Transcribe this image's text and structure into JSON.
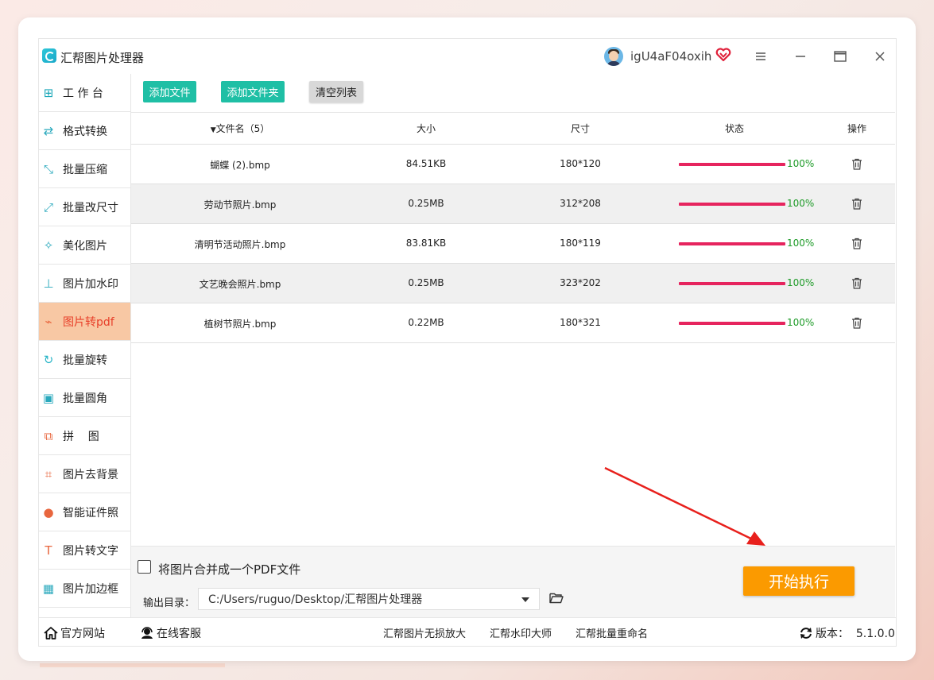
{
  "app": {
    "title": "汇帮图片处理器",
    "username": "igU4aF04oxih"
  },
  "sidebar": {
    "items": [
      {
        "label": "工 作 台",
        "icon": "grid-icon"
      },
      {
        "label": "格式转换",
        "icon": "convert-icon"
      },
      {
        "label": "批量压缩",
        "icon": "compress-icon"
      },
      {
        "label": "批量改尺寸",
        "icon": "resize-icon"
      },
      {
        "label": "美化图片",
        "icon": "beautify-icon"
      },
      {
        "label": "图片加水印",
        "icon": "watermark-icon"
      },
      {
        "label": "图片转pdf",
        "icon": "pdf-icon",
        "active": true
      },
      {
        "label": "批量旋转",
        "icon": "rotate-icon"
      },
      {
        "label": "批量圆角",
        "icon": "round-corner-icon"
      },
      {
        "label": "拼    图",
        "icon": "puzzle-icon"
      },
      {
        "label": "图片去背景",
        "icon": "crop-icon"
      },
      {
        "label": "智能证件照",
        "icon": "person-icon"
      },
      {
        "label": "图片转文字",
        "icon": "text-icon"
      },
      {
        "label": "图片加边框",
        "icon": "frame-icon"
      }
    ]
  },
  "toolbar": {
    "add_file": "添加文件",
    "add_folder": "添加文件夹",
    "clear_list": "清空列表"
  },
  "table": {
    "headers": {
      "name": "文件名（5）",
      "size": "大小",
      "dimensions": "尺寸",
      "status": "状态",
      "action": "操作"
    },
    "rows": [
      {
        "name": "蝴蝶 (2).bmp",
        "size": "84.51KB",
        "dimensions": "180*120",
        "progress_pct": "100%",
        "progress": 1.0
      },
      {
        "name": "劳动节照片.bmp",
        "size": "0.25MB",
        "dimensions": "312*208",
        "progress_pct": "100%",
        "progress": 1.0
      },
      {
        "name": "清明节活动照片.bmp",
        "size": "83.81KB",
        "dimensions": "180*119",
        "progress_pct": "100%",
        "progress": 1.0
      },
      {
        "name": "文艺晚会照片.bmp",
        "size": "0.25MB",
        "dimensions": "323*202",
        "progress_pct": "100%",
        "progress": 1.0
      },
      {
        "name": "植树节照片.bmp",
        "size": "0.22MB",
        "dimensions": "180*321",
        "progress_pct": "100%",
        "progress": 1.0
      }
    ]
  },
  "options": {
    "merge_pdf_label": "将图片合并成一个PDF文件",
    "merge_pdf_checked": false,
    "output_label": "输出目录：",
    "output_path": "C:/Users/ruguo/Desktop/汇帮图片处理器",
    "start_label": "开始执行"
  },
  "footer": {
    "website": "官方网站",
    "support": "在线客服",
    "link1": "汇帮图片无损放大",
    "link2": "汇帮水印大师",
    "link3": "汇帮批量重命名",
    "version": "版本：  5.1.0.0"
  },
  "colors": {
    "accent_teal": "#1fbfa5",
    "start_orange": "#fb9a00",
    "progress": "#e6245e",
    "active_bg": "#f8c8a4",
    "active_text": "#e8402a"
  }
}
